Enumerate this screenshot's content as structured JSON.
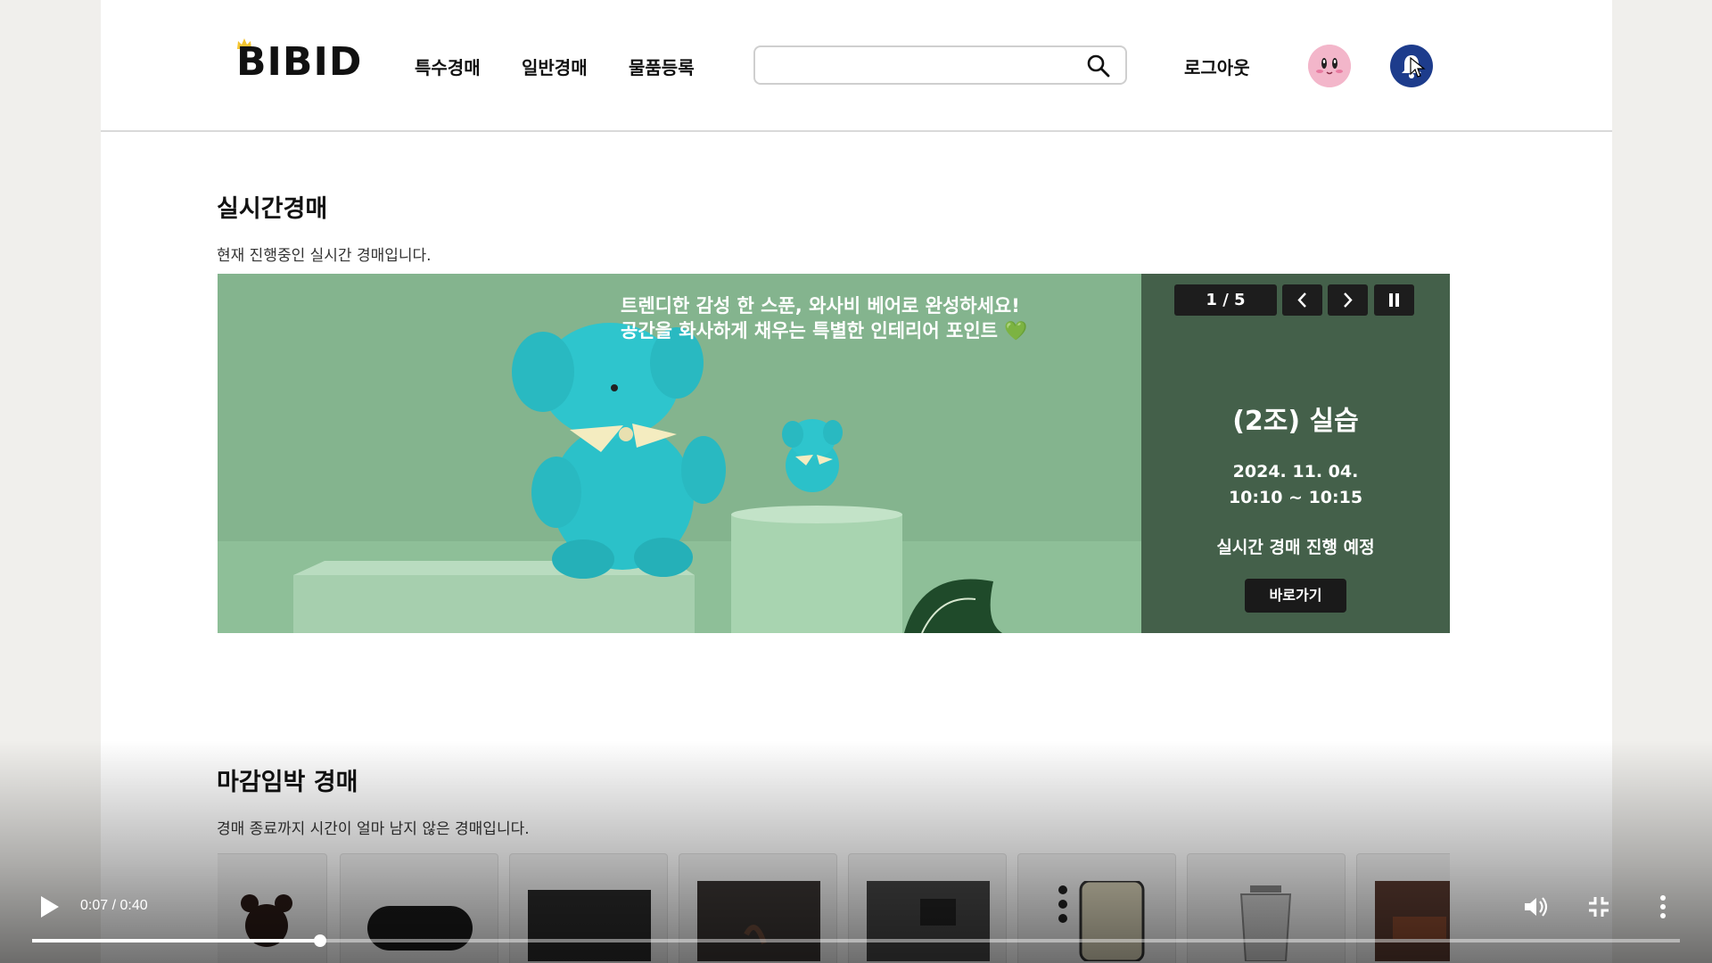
{
  "header": {
    "logo": "BIBID",
    "nav": [
      "특수경매",
      "일반경매",
      "물품등록"
    ],
    "search_placeholder": "",
    "logout": "로그아웃"
  },
  "realtime": {
    "title": "실시간경매",
    "desc": "현재 진행중인 실시간 경매입니다.",
    "banner": {
      "line1": "트렌디한 감성 한 스푼, 와사비 베어로 완성하세요!",
      "line2": "공간을 화사하게 채우는 특별한 인테리어 포인트 💚",
      "counter": "1 / 5",
      "prev": "‹",
      "next": "›",
      "pause": "II",
      "auction_title": "(2조) 실습",
      "date": "2024. 11. 04.",
      "time": "10:10 ~ 10:15",
      "status": "실시간 경매 진행 예정",
      "goto": "바로가기"
    }
  },
  "closing": {
    "title": "마감임박 경매",
    "desc": "경매 종료까지 시간이 얼마 남지 않은 경매입니다.",
    "card_count": 8
  },
  "video": {
    "time": "0:07 / 0:40",
    "progress": 0.175
  },
  "colors": {
    "banner_green": "#84b48e",
    "panel_green": "#44604a",
    "bear_teal": "#2bc1c9",
    "bell_blue": "#1d3c8c"
  }
}
